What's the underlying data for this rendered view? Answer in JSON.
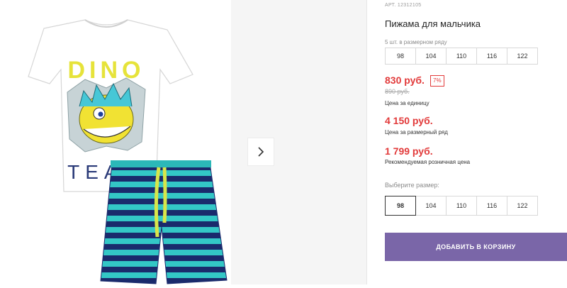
{
  "product": {
    "sku": "АРТ. 12312105",
    "title": "Пижама для мальчика",
    "image_alt_text": [
      "DINO",
      "TEAM"
    ]
  },
  "pack": {
    "caption": "5 шт. в размерном ряду",
    "sizes": [
      "98",
      "104",
      "110",
      "116",
      "122"
    ]
  },
  "prices": {
    "unit_price": "830 руб.",
    "discount": "7%",
    "old_price": "890 руб.",
    "unit_label": "Цена за единицу",
    "row_price": "4 150 руб.",
    "row_label": "Цена за размерный ряд",
    "retail_price": "1 799 руб.",
    "retail_label": "Рекомендуемая розничная цена"
  },
  "size_picker": {
    "label": "Выберите размер:",
    "options": [
      "98",
      "104",
      "110",
      "116",
      "122"
    ],
    "selected": "98"
  },
  "cart": {
    "button_label": "ДОБАВИТЬ В КОРЗИНУ"
  },
  "colors": {
    "accent": "#7a66a8",
    "price_red": "#e23a3a"
  }
}
